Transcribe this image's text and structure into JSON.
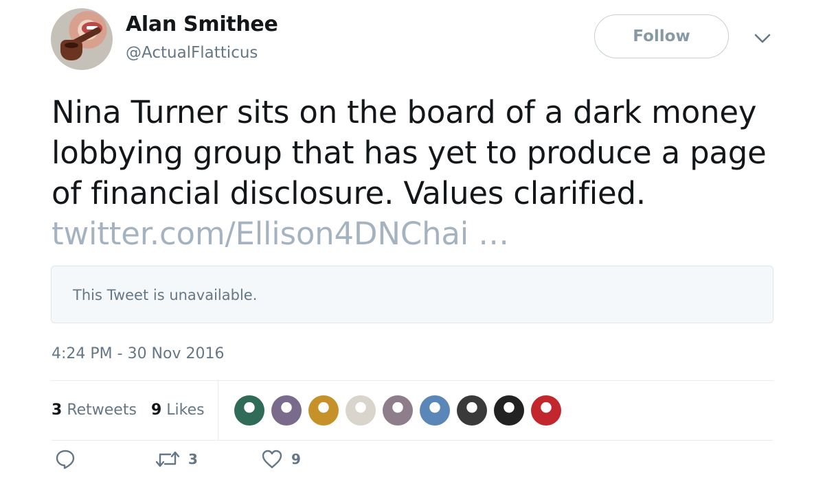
{
  "author": {
    "display_name": "Alan Smithee",
    "handle": "@ActualFlatticus",
    "avatar_icon": "pipe-smoking-mouth-avatar"
  },
  "header": {
    "follow_label": "Follow",
    "menu_icon": "chevron-down-icon"
  },
  "tweet": {
    "text": "Nina Turner sits on the board of a dark money lobbying group that has yet to produce a page of financial disclosure.  Values clarified. ",
    "link_text": "twitter.com/Ellison4DNChai …",
    "quoted_status": "This Tweet is unavailable.",
    "timestamp": "4:24 PM - 30 Nov 2016"
  },
  "stats": {
    "retweets_count": "3",
    "retweets_label": "Retweets",
    "likes_count": "9",
    "likes_label": "Likes"
  },
  "likers": [
    {
      "name": "liker-1",
      "color": "#2f6b57"
    },
    {
      "name": "liker-2",
      "color": "#7a6a8c"
    },
    {
      "name": "liker-3",
      "color": "#c7912a"
    },
    {
      "name": "liker-4",
      "color": "#d9d4cc"
    },
    {
      "name": "liker-5",
      "color": "#8e7d8a"
    },
    {
      "name": "liker-6",
      "color": "#5b86b8"
    },
    {
      "name": "liker-7",
      "color": "#3a3a3a"
    },
    {
      "name": "liker-8",
      "color": "#222222"
    },
    {
      "name": "liker-9",
      "color": "#c1272d"
    }
  ],
  "actions": {
    "reply_icon": "reply-icon",
    "retweet_icon": "retweet-icon",
    "retweet_count": "3",
    "like_icon": "heart-icon",
    "like_count": "9"
  },
  "colors": {
    "text_primary": "#14171a",
    "text_secondary": "#657786",
    "link_muted": "#a4b3bf",
    "border": "#e6ecf0",
    "quoted_bg": "#f5f8fa"
  }
}
